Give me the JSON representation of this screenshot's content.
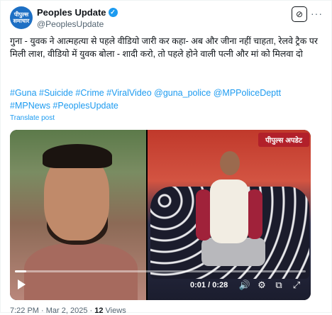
{
  "account": {
    "avatar_text": "पीपुल्स समाचार",
    "display_name": "Peoples Update",
    "handle": "@PeoplesUpdate"
  },
  "tweet": {
    "text": "गुना - युवक ने आत्महत्या से पहले वीडियो जारी कर कहा- अब और जीना नहीं चाहता, रेलवे ट्रैक पर मिली लाश, वीडियो में युवक बोला - शादी करो, तो पहले होने वाली पत्नी और मां को मिलवा दो",
    "hashtags": "#Guna #Suicide #Crime #ViralVideo @guna_police @MPPoliceDeptt #MPNews #PeoplesUpdate",
    "translate_label": "Translate post"
  },
  "media": {
    "logo_text": "पीपुल्स अपडेट",
    "current_time": "0:01",
    "duration": "0:28",
    "time_separator": "/",
    "progress_fraction": 0.04
  },
  "footer": {
    "time": "7:22 PM",
    "date": "Mar 2, 2025",
    "views_count": "12",
    "views_label": "Views"
  },
  "icons": {
    "verified": "verified-badge-icon",
    "grok": "grok-icon",
    "more": "more-icon",
    "play": "play-icon",
    "volume": "volume-icon",
    "settings": "settings-icon",
    "pip": "picture-in-picture-icon",
    "fullscreen": "fullscreen-icon"
  },
  "colors": {
    "accent": "#1d9bf0",
    "logo_red": "#b2202a"
  }
}
